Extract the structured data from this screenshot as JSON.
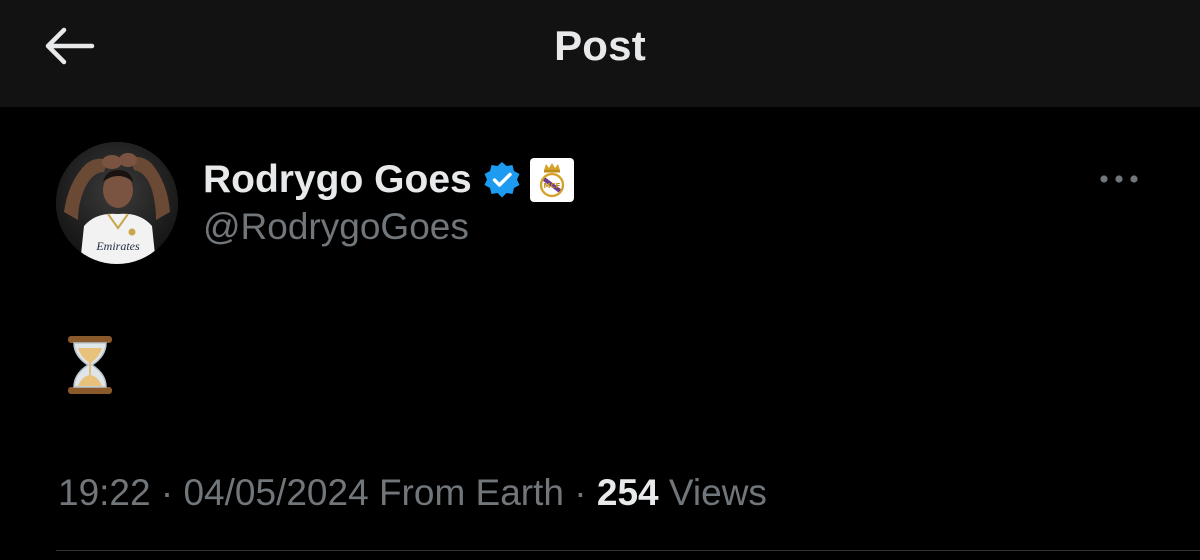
{
  "header": {
    "back_icon": "arrow-left-icon",
    "title": "Post"
  },
  "author": {
    "display_name": "Rodrygo Goes",
    "handle": "@RodrygoGoes",
    "verified_icon": "verified-check-icon",
    "affiliation_icon": "real-madrid-crest-icon",
    "avatar_shirt_text": "Emirates"
  },
  "tweet": {
    "content_icon": "hourglass-emoji"
  },
  "meta": {
    "time": "19:22",
    "separator": " · ",
    "date": "04/05/2024",
    "source": "From Earth",
    "views_count": "254",
    "views_label": "Views"
  },
  "colors": {
    "background": "#000000",
    "header_bg": "#121212",
    "primary_text": "#e7e9ea",
    "secondary_text": "#71767b",
    "verified_blue": "#1d9bf0"
  }
}
